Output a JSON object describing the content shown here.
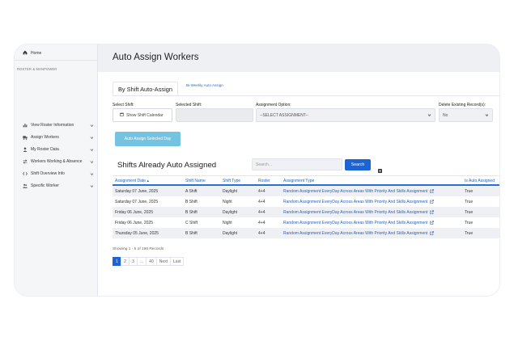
{
  "sidebar": {
    "home_label": "Home",
    "section_label": "ROSTER & MANPOWER",
    "items": [
      {
        "label": "View Roster Information",
        "icon": "bar-chart-icon"
      },
      {
        "label": "Assign Workers",
        "icon": "truck-icon"
      },
      {
        "label": "My Roster Data",
        "icon": "user-icon"
      },
      {
        "label": "Workers Working & Absence",
        "icon": "arrows-icon"
      },
      {
        "label": "Shift Overview Info",
        "icon": "code-icon"
      },
      {
        "label": "Specific Worker",
        "icon": "users-icon"
      }
    ]
  },
  "header": {
    "title": "Auto Assign Workers"
  },
  "tabs": [
    {
      "label": "By Shift Auto-Assign",
      "active": true
    },
    {
      "label": "Bi-Weekly Auto Assign",
      "active": false
    }
  ],
  "form": {
    "select_shift_label": "Select Shift:",
    "show_calendar_label": "Show Shift Calendar",
    "selected_shift_label": "Selected Shift:",
    "assignment_option_label": "Assignment Option:",
    "assignment_option_value": "--SELECT ASSIGNMENT--",
    "delete_existing_label": "Delete Existing Record(s):",
    "delete_existing_value": "No",
    "auto_assign_button": "Auto Assign Selected Day"
  },
  "assigned": {
    "title": "Shifts Already Auto Assigned",
    "search_placeholder": "Search...",
    "search_button": "Search",
    "columns": [
      "Assignment Date ▴",
      "Shift Name",
      "Shift Type",
      "Roster",
      "Assignment Type",
      "Is Auto Assigned"
    ],
    "rows": [
      [
        "Saturday 07 June, 2025",
        "A Shift",
        "Daylight",
        "4+4",
        "Random Assignment EveryDay Across Areas With Priority And Skills Assignment",
        "True"
      ],
      [
        "Saturday 07 June, 2025",
        "B Shift",
        "Night",
        "4+4",
        "Random Assignment EveryDay Across Areas With Priority And Skills Assignment",
        "True"
      ],
      [
        "Friday 06 June, 2025",
        "B Shift",
        "Daylight",
        "4+4",
        "Random Assignment EveryDay Across Areas With Priority And Skills Assignment",
        "True"
      ],
      [
        "Friday 06 June, 2025",
        "C Shift",
        "Night",
        "4+4",
        "Random Assignment EveryDay Across Areas With Priority And Skills Assignment",
        "True"
      ],
      [
        "Thursday 05 June, 2025",
        "B Shift",
        "Daylight",
        "4+4",
        "Random Assignment EveryDay Across Areas With Priority And Skills Assignment",
        "True"
      ]
    ],
    "records_text": "Showing 1 - 5 of 196 Records",
    "pagination": [
      "1",
      "2",
      "3",
      "...",
      "40",
      "Next",
      "Last"
    ],
    "current_page": "1"
  },
  "colors": {
    "accent": "#1c64d6",
    "auto_button": "#74c3e1",
    "header_bg": "#eef0f3",
    "sidebar_bg": "#f5f6f8"
  }
}
